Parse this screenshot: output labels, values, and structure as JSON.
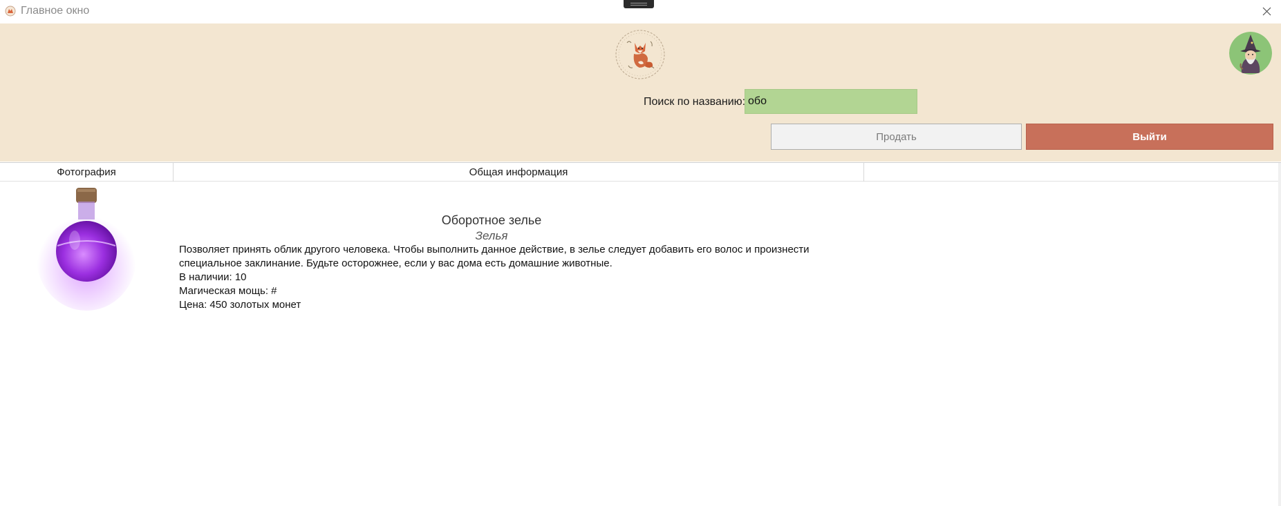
{
  "window": {
    "title": "Главное окно"
  },
  "header": {
    "search_label": "Поиск по названию:",
    "search_value": "обо",
    "sell_label": "Продать",
    "exit_label": "Выйти",
    "logo_icon": "fox-logo-icon",
    "avatar_icon": "wizard-avatar-icon"
  },
  "table": {
    "columns": [
      "Фотография",
      "Общая информация",
      ""
    ],
    "rows": [
      {
        "photo_icon": "purple-potion-bottle",
        "name": "Оборотное зелье",
        "category": "Зелья",
        "description_line1": "Позволяет принять облик другого человека. Чтобы выполнить данное действие, в зелье следует добавить его волос и произнести",
        "description_line2": "специальное заклинание. Будьте осторожнее, если у вас дома есть домашние животные.",
        "stock": "В наличии: 10",
        "power": "Магическая мощь: #",
        "price": "Цена: 450 золотых монет"
      }
    ]
  },
  "colors": {
    "header_bg": "#f3e6d1",
    "search_bg": "#b2d593",
    "exit_bg": "#c8705a",
    "sell_bg": "#f2f2f2"
  }
}
